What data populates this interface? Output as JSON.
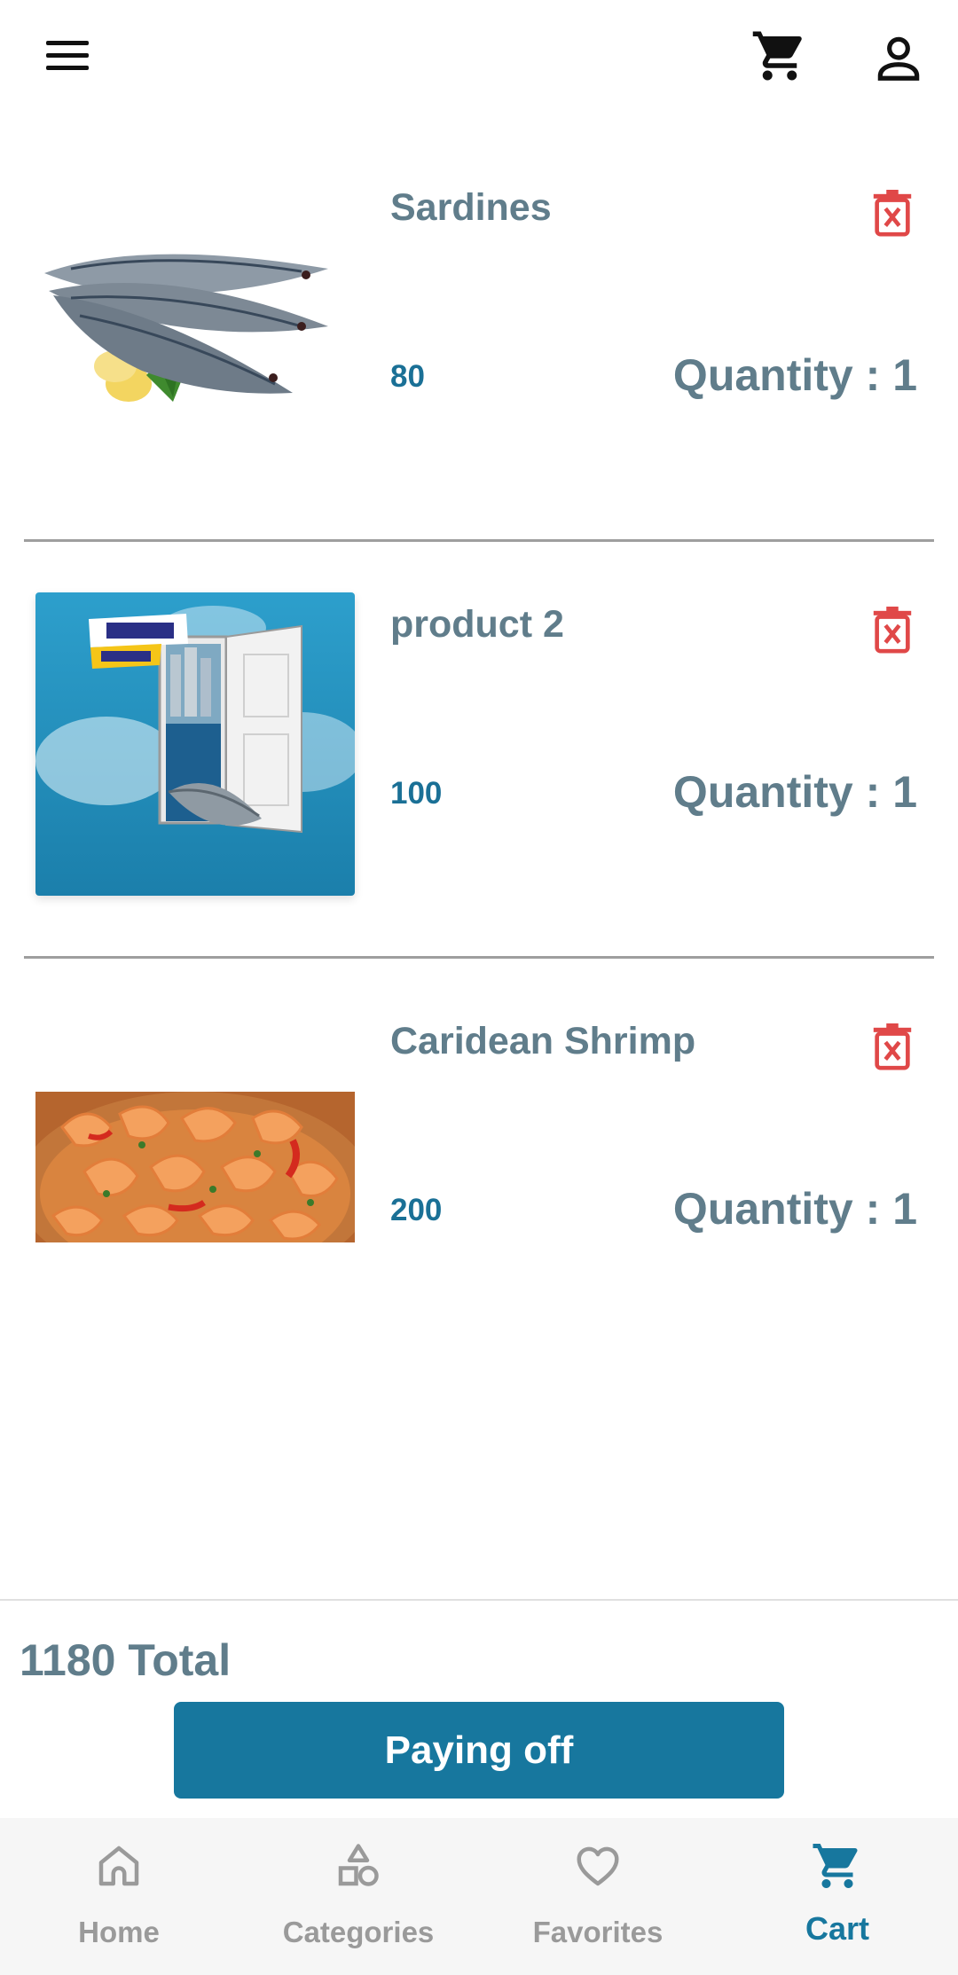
{
  "header": {
    "menu_icon": "hamburger-menu-icon",
    "cart_icon": "cart-icon",
    "account_icon": "account-icon"
  },
  "cart": {
    "items": [
      {
        "name": "Sardines",
        "price": "80",
        "quantity_label": "Quantity",
        "separator": ":",
        "quantity": "1",
        "image": "sardines-photo",
        "delete_icon": "delete-icon"
      },
      {
        "name": "product 2",
        "price": "100",
        "quantity_label": "Quantity",
        "separator": ":",
        "quantity": "1",
        "image": "product-2-poster",
        "delete_icon": "delete-icon"
      },
      {
        "name": "Caridean Shrimp",
        "price": "200",
        "quantity_label": "Quantity",
        "separator": ":",
        "quantity": "1",
        "image": "shrimp-photo",
        "delete_icon": "delete-icon"
      }
    ],
    "total_value": "1180",
    "total_label": "Total",
    "pay_button_label": "Paying off"
  },
  "bottom_nav": {
    "items": [
      {
        "label": "Home",
        "icon": "home-icon",
        "active": false
      },
      {
        "label": "Categories",
        "icon": "categories-icon",
        "active": false
      },
      {
        "label": "Favorites",
        "icon": "heart-icon",
        "active": false
      },
      {
        "label": "Cart",
        "icon": "cart-icon",
        "active": true
      }
    ]
  },
  "colors": {
    "accent": "#17779e",
    "price": "#1a7096",
    "text": "#607d8b",
    "delete": "#e04848",
    "inactive_nav": "#9a9a9a"
  }
}
